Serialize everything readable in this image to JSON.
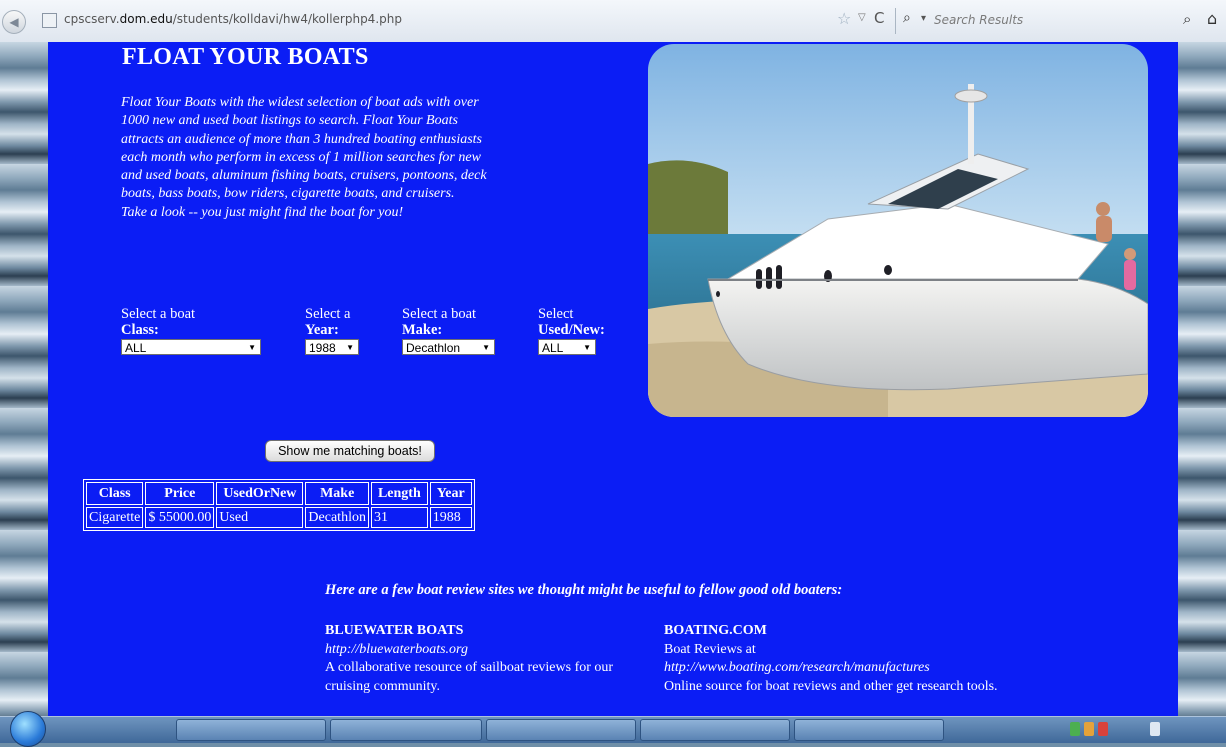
{
  "browser": {
    "back_glyph": "◀",
    "url_prefix": "cpscserv.",
    "url_domain": "dom.edu",
    "url_path": "/students/kolldavi/hw4/kollerphp4.php",
    "star_glyph": "☆",
    "dropdown_glyph": "▽",
    "reload_glyph": "C",
    "search_engine_glyph": "⌕",
    "search_dropdown_glyph": "▾",
    "search_placeholder": "Search Results",
    "search_go_glyph": "⌕",
    "home_glyph": "⌂"
  },
  "page": {
    "title": "FLOAT YOUR BOATS",
    "intro": "Float Your Boats with the widest selection of boat ads with over 1000 new and used boat listings to search. Float Your Boats attracts an audience of more than 3 hundred boating enthusiasts each month who perform in excess of 1 million searches for new and used boats, aluminum fishing boats, cruisers, pontoons, deck boats, bass boats, bow riders, cigarette boats, and cruisers.",
    "intro_tagline": "Take a look -- you just might find the boat for you!"
  },
  "filters": {
    "class": {
      "label": "Select a boat",
      "label_bold": "Class:",
      "value": "ALL"
    },
    "year": {
      "label": "Select a",
      "label_bold": "Year:",
      "value": "1988"
    },
    "make": {
      "label": "Select a boat",
      "label_bold": "Make:",
      "value": "Decathlon"
    },
    "used": {
      "label": "Select",
      "label_bold": "Used/New:",
      "value": "ALL"
    },
    "dropdown_arrow": "▼"
  },
  "search_button": {
    "label": "Show me matching boats!"
  },
  "results": {
    "headers": [
      "Class",
      "Price",
      "UsedOrNew",
      "Make",
      "Length",
      "Year"
    ],
    "rows": [
      [
        "Cigarette",
        "$ 55000.00",
        "Used",
        "Decathlon",
        "31",
        "1988"
      ]
    ]
  },
  "reviews": {
    "intro": "Here are a few boat review sites we thought might be useful to fellow good old boaters:",
    "sites": [
      {
        "title": "BLUEWATER BOATS",
        "url": "http://bluewaterboats.org",
        "lines": [
          "A collaborative resource of sailboat reviews for our cruising community."
        ]
      },
      {
        "title": "BOATING.COM",
        "prefix": "Boat Reviews at",
        "url": "http://www.boating.com/research/manufactures",
        "lines": [
          "Online source for boat reviews and other get research tools."
        ]
      }
    ]
  },
  "colors": {
    "page_background": "#0b1df5",
    "text": "#ffffff"
  }
}
